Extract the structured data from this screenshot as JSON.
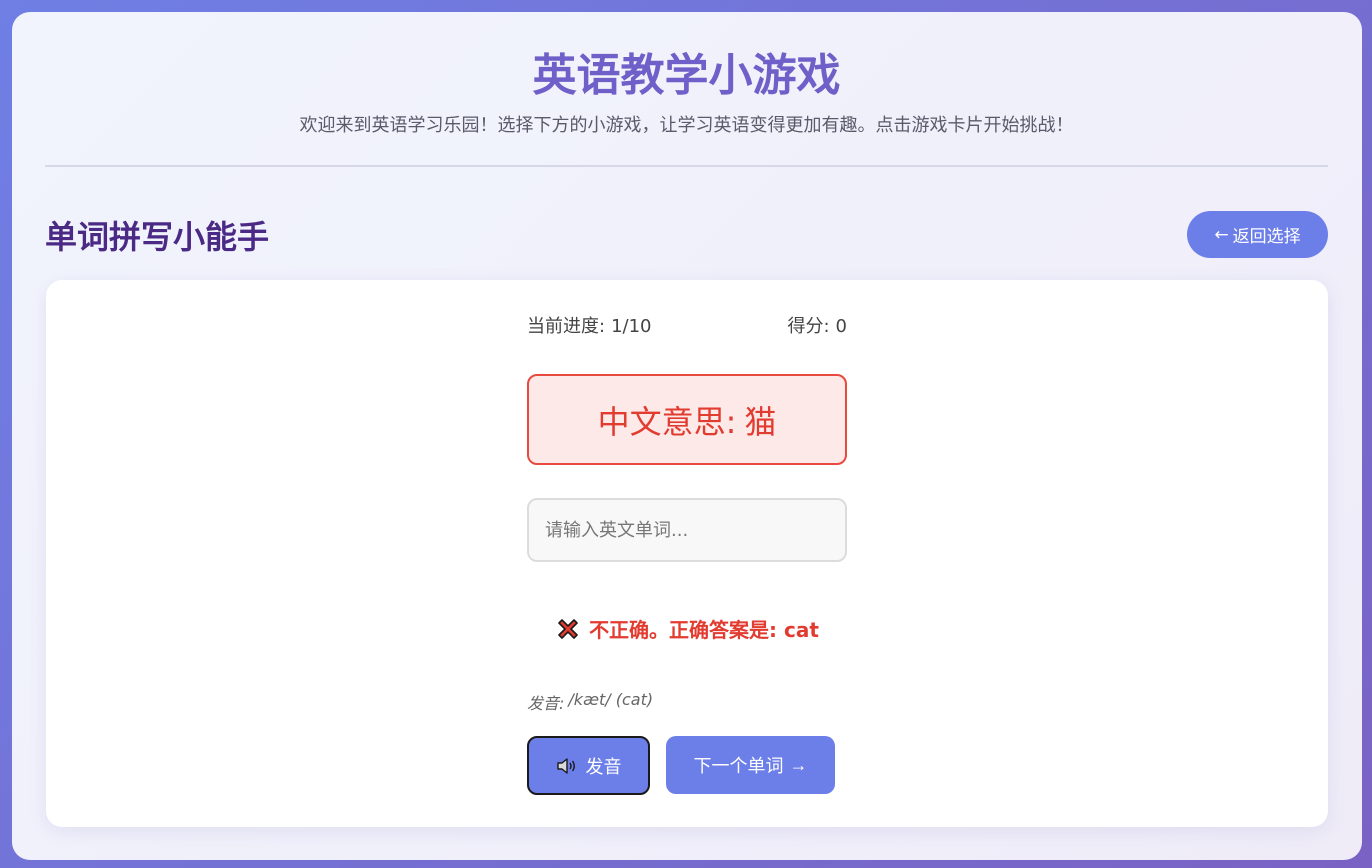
{
  "header": {
    "title": "英语教学小游戏",
    "subtitle": "欢迎来到英语学习乐园！选择下方的小游戏，让学习英语变得更加有趣。点击游戏卡片开始挑战！"
  },
  "game": {
    "title": "单词拼写小能手",
    "back_arrow": "←",
    "back_label": "返回选择"
  },
  "stats": {
    "progress_label": "当前进度:",
    "progress_value": "1/10",
    "score_label": "得分:",
    "score_value": "0"
  },
  "question": {
    "meaning_label": "中文意思:",
    "meaning_value": "猫"
  },
  "input": {
    "placeholder": "请输入英文单词...",
    "value": ""
  },
  "feedback": {
    "icon": "cross-mark-icon",
    "text": "不正确。正确答案是: cat",
    "color": "#e23b30"
  },
  "pronunciation": {
    "label": "发音:",
    "value": "/kæt/ (cat)"
  },
  "buttons": {
    "speak_icon": "speaker-icon",
    "speak_label": "发音",
    "next_label": "下一个单词",
    "next_arrow": "→"
  },
  "colors": {
    "accent": "#6c7ee8",
    "title": "#6f5fc8",
    "game_title": "#4b2a86",
    "error": "#e23b30"
  }
}
